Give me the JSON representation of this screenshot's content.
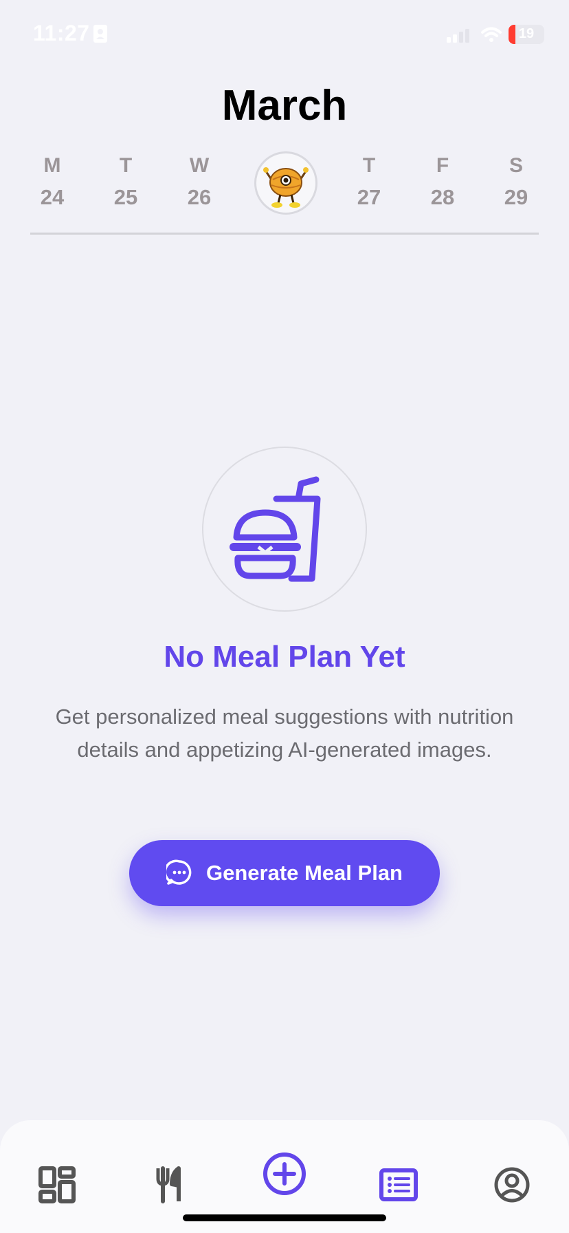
{
  "status_bar": {
    "time": "11:27",
    "battery": "19",
    "battery_level": 0.19,
    "battery_color": "#ff3b30"
  },
  "header": {
    "month": "March"
  },
  "week": {
    "days": [
      {
        "letter": "M",
        "number": "24"
      },
      {
        "letter": "T",
        "number": "25"
      },
      {
        "letter": "W",
        "number": "26"
      },
      {
        "letter": "T",
        "number": "27"
      },
      {
        "letter": "F",
        "number": "28"
      },
      {
        "letter": "S",
        "number": "29"
      }
    ],
    "today_icon": "mascot-avatar"
  },
  "empty_state": {
    "icon": "burger-drink-icon",
    "title": "No Meal Plan Yet",
    "description": "Get personalized meal suggestions with nutrition details and appetizing AI-generated images.",
    "button_label": "Generate Meal Plan",
    "button_icon": "chat-bubble-icon"
  },
  "tab_bar": {
    "tabs": [
      {
        "icon": "dashboard-icon",
        "active": false
      },
      {
        "icon": "fork-knife-icon",
        "active": false
      },
      {
        "icon": "plus-circle-icon",
        "active": true
      },
      {
        "icon": "list-icon",
        "active": true
      },
      {
        "icon": "profile-icon",
        "active": false
      }
    ]
  },
  "colors": {
    "accent": "#6246ea",
    "background": "#f1f1f7",
    "muted_text": "#9b9598",
    "icon_gray": "#555555"
  }
}
